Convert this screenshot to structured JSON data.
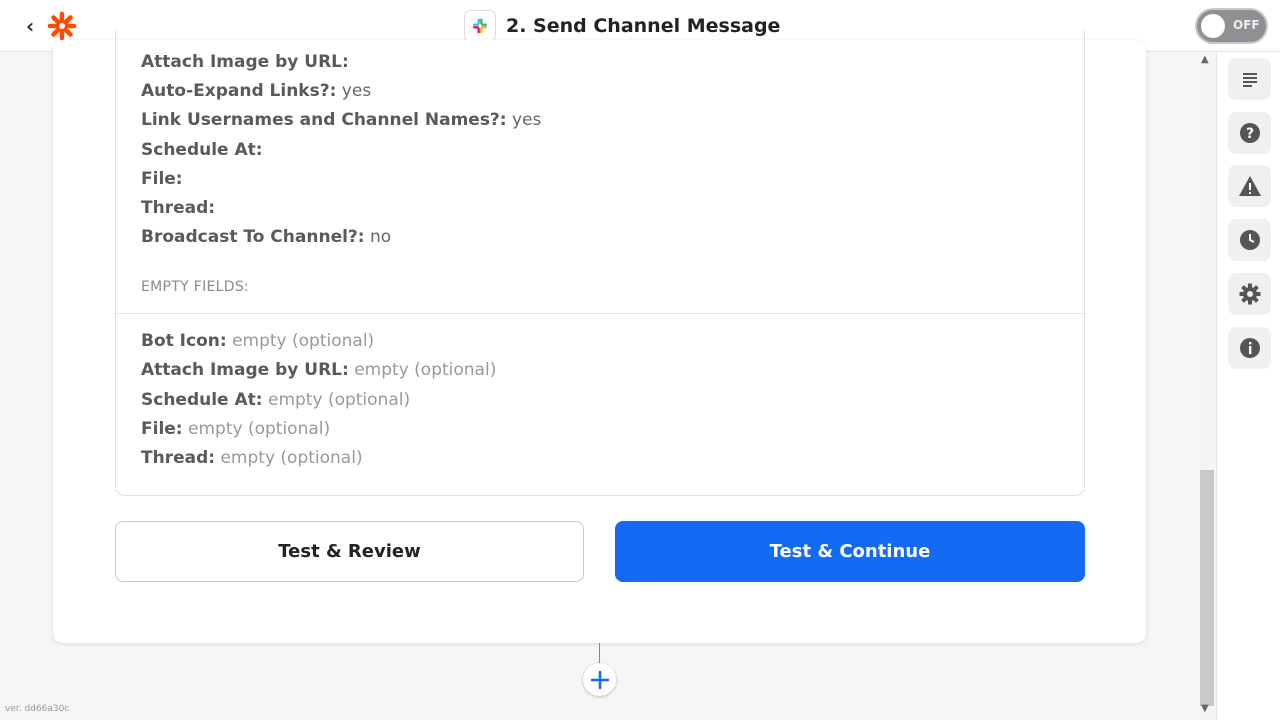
{
  "header": {
    "back_label": "‹",
    "title": "2. Send Channel Message",
    "toggle_label": "OFF"
  },
  "fields": [
    {
      "label": "Attach Image by URL:",
      "value": ""
    },
    {
      "label": "Auto-Expand Links?:",
      "value": "yes"
    },
    {
      "label": "Link Usernames and Channel Names?:",
      "value": "yes"
    },
    {
      "label": "Schedule At:",
      "value": ""
    },
    {
      "label": "File:",
      "value": ""
    },
    {
      "label": "Thread:",
      "value": ""
    },
    {
      "label": "Broadcast To Channel?:",
      "value": "no"
    }
  ],
  "empty_section": {
    "header": "EMPTY FIELDS:",
    "items": [
      {
        "label": "Bot Icon:",
        "value": "empty (optional)"
      },
      {
        "label": "Attach Image by URL:",
        "value": "empty (optional)"
      },
      {
        "label": "Schedule At:",
        "value": "empty (optional)"
      },
      {
        "label": "File:",
        "value": "empty (optional)"
      },
      {
        "label": "Thread:",
        "value": "empty (optional)"
      }
    ]
  },
  "actions": {
    "review_label": "Test & Review",
    "continue_label": "Test & Continue"
  },
  "footer": {
    "version": "ver. dd66a30c"
  },
  "colors": {
    "accent": "#136bf5",
    "logo": "#ff4a00"
  },
  "right_rail_icons": [
    "notes-icon",
    "help-icon",
    "warning-icon",
    "history-icon",
    "settings-icon",
    "info-icon"
  ]
}
